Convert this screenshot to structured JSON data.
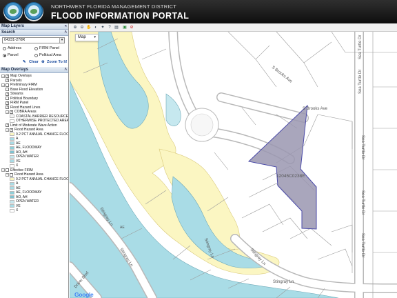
{
  "header": {
    "org_name": "NORTHWEST FLORIDA MANAGEMENT DISTRICT",
    "portal_title": "FLOOD INFORMATION PORTAL"
  },
  "sidebar": {
    "map_layers_title": "Map Layers",
    "search_title": "Search",
    "search_value": "04231-270R",
    "radios": [
      {
        "label": "Address",
        "checked": false
      },
      {
        "label": "FIRM Panel",
        "checked": false
      },
      {
        "label": "Parcel",
        "checked": true
      },
      {
        "label": "Political Area",
        "checked": false
      }
    ],
    "clear_label": "Clear",
    "zoom_label": "Zoom To It!",
    "map_overlays_title": "Map Overlays",
    "tree": [
      {
        "label": "Map Overlays",
        "level": 0,
        "expand": "-",
        "checked": true
      },
      {
        "label": "Parcels",
        "level": 1,
        "checked": true
      },
      {
        "label": "Preliminary FIRM",
        "level": 0,
        "expand": "-",
        "checked": false
      },
      {
        "label": "Base Flood Elevation",
        "level": 1,
        "checked": false
      },
      {
        "label": "Streams",
        "level": 1,
        "checked": true
      },
      {
        "label": "Political Boundary",
        "level": 1,
        "checked": false
      },
      {
        "label": "FIRM Panel",
        "level": 1,
        "checked": true
      },
      {
        "label": "Flood Hazard Lines",
        "level": 1,
        "checked": true
      },
      {
        "label": "COBRA Areas",
        "level": 1,
        "expand": "-",
        "checked": true
      },
      {
        "label": "COASTAL BARRIER RESOURCE",
        "level": 2,
        "swatch": "#f4f4f4"
      },
      {
        "label": "OTHERWISE PROTECTED AREA",
        "level": 2,
        "swatch": "#ffffff"
      },
      {
        "label": "Limit of Moderate Wave Action",
        "level": 1,
        "checked": true
      },
      {
        "label": "Flood Hazard Area",
        "level": 1,
        "expand": "-",
        "checked": true
      },
      {
        "label": "0.2 PCT ANNUAL CHANCE FLOO",
        "level": 2,
        "swatch": "#fbf6c2"
      },
      {
        "label": "A",
        "level": 2,
        "swatch": "#a9dce6"
      },
      {
        "label": "AE",
        "level": 2,
        "swatch": "#a9dce6"
      },
      {
        "label": "AE, FLOODWAY",
        "level": 2,
        "swatch": "#8fcfd9"
      },
      {
        "label": "AO, AH",
        "level": 2,
        "swatch": "#7fc3d1"
      },
      {
        "label": "OPEN WATER",
        "level": 2,
        "swatch": "#c6e8ef"
      },
      {
        "label": "VE",
        "level": 2,
        "swatch": "#a9dce6"
      },
      {
        "label": "X",
        "level": 2,
        "swatch": "#ffffff"
      },
      {
        "label": "Effective FIRM",
        "level": 0,
        "expand": "-",
        "checked": false
      },
      {
        "label": "Flood Hazard Area",
        "level": 1,
        "expand": "-",
        "checked": false
      },
      {
        "label": "0.2 PCT ANNUAL CHANCE FLOO",
        "level": 2,
        "swatch": "#fbf6c2"
      },
      {
        "label": "A",
        "level": 2,
        "swatch": "#a9dce6"
      },
      {
        "label": "AE",
        "level": 2,
        "swatch": "#a9dce6"
      },
      {
        "label": "AE, FLOODWAY",
        "level": 2,
        "swatch": "#8fcfd9"
      },
      {
        "label": "AO, AH",
        "level": 2,
        "swatch": "#7fc3d1"
      },
      {
        "label": "OPEN WATER",
        "level": 2,
        "swatch": "#c6e8ef"
      },
      {
        "label": "VE",
        "level": 2,
        "swatch": "#a9dce6"
      },
      {
        "label": "X",
        "level": 2,
        "swatch": "#ffffff"
      }
    ]
  },
  "map": {
    "map_type": "Map",
    "parcel_label": "12045C0238E",
    "roads": [
      "S Brooks Ave",
      "S Brooks Ave",
      "Sea Turtle Dr",
      "Sea Turtle Dr",
      "Sea Turtle Dr",
      "Sea Turtle Dr",
      "Sea Turtle Dr",
      "Stingray Ln",
      "Stingray Ln",
      "Stingray Ln",
      "Stingray Ln",
      "Stingray Ln",
      "Driver Blvd"
    ],
    "google_label": "Google",
    "colors": {
      "zone_ae": "#a9dce6",
      "zone_x500": "#fbf6c2",
      "parcel_fill": "#9a97b0",
      "parcel_stroke": "#4a4aa8"
    }
  }
}
